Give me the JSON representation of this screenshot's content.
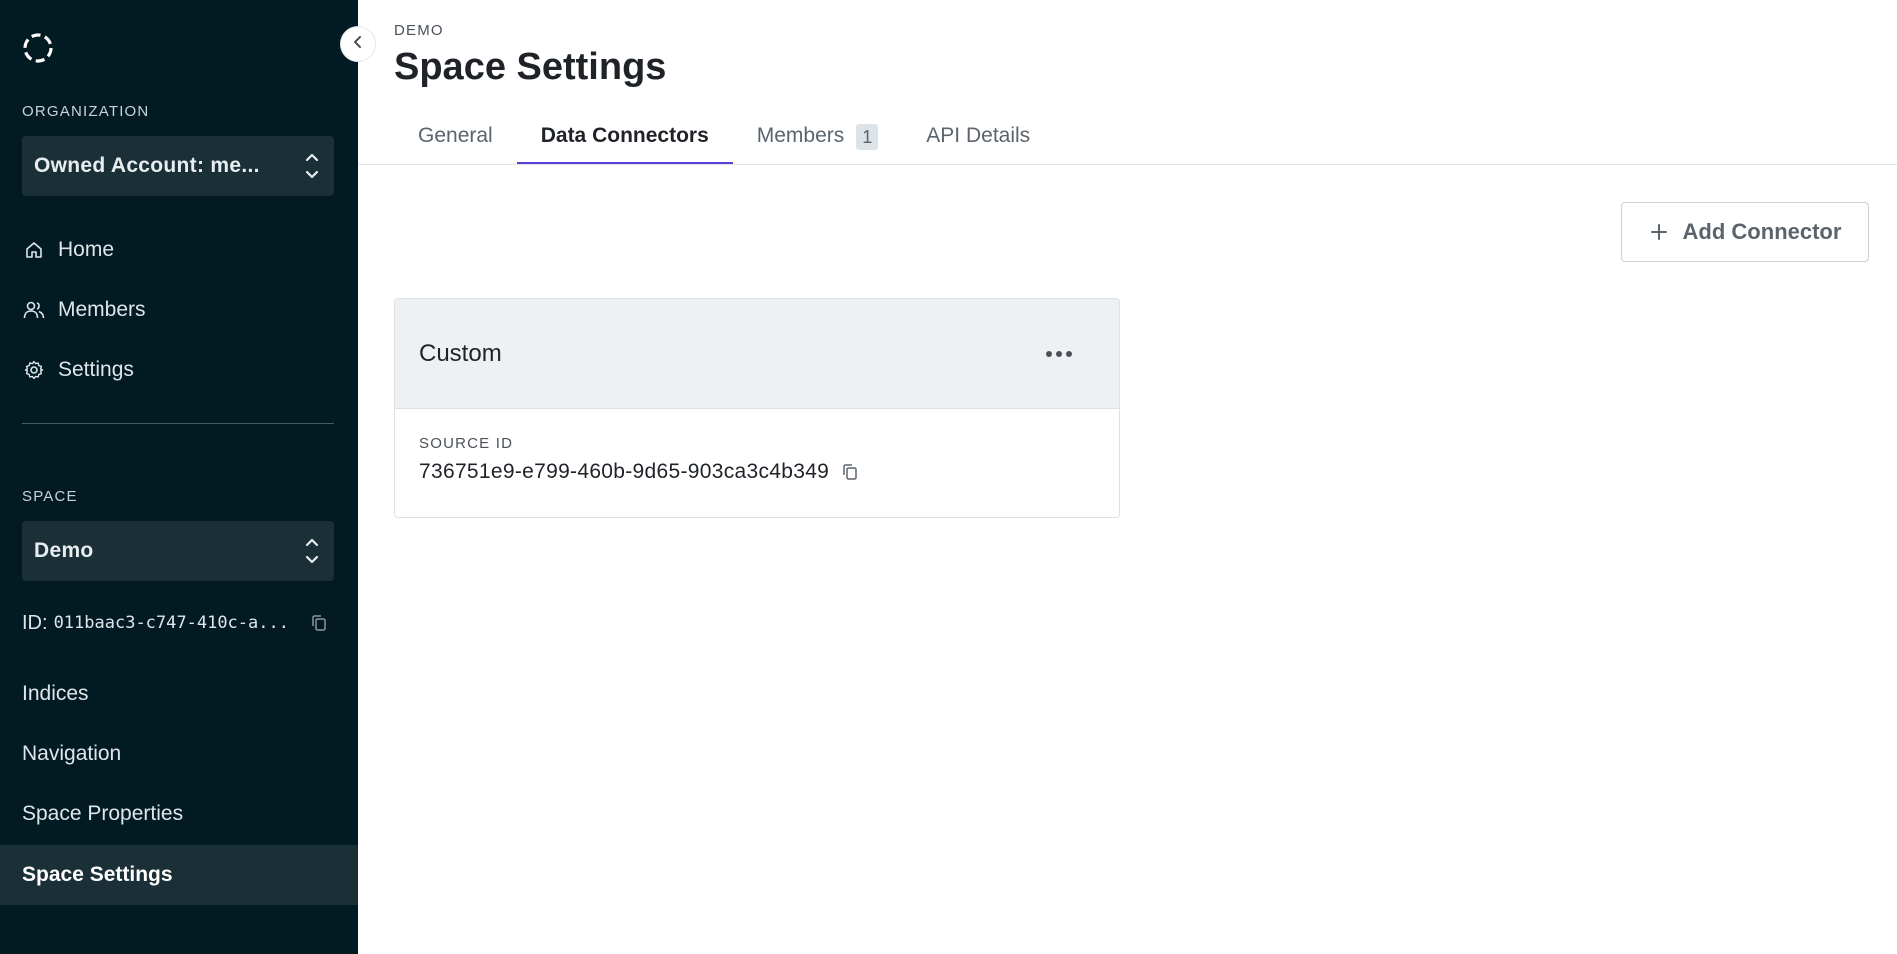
{
  "sidebar": {
    "organization_label": "ORGANIZATION",
    "organization_value": "Owned Account: me...",
    "nav": [
      {
        "label": "Home",
        "icon": "home-icon"
      },
      {
        "label": "Members",
        "icon": "users-icon"
      },
      {
        "label": "Settings",
        "icon": "gear-icon"
      }
    ],
    "space_label": "SPACE",
    "space_value": "Demo",
    "space_id_prefix": "ID:",
    "space_id_value": "011baac3-c747-410c-a...",
    "links": [
      "Indices",
      "Navigation",
      "Space Properties"
    ],
    "active_link": "Space Settings"
  },
  "main": {
    "breadcrumb": "DEMO",
    "title": "Space Settings",
    "tabs": [
      {
        "label": "General",
        "active": false
      },
      {
        "label": "Data Connectors",
        "active": true
      },
      {
        "label": "Members",
        "active": false,
        "badge": "1"
      },
      {
        "label": "API Details",
        "active": false
      }
    ],
    "add_button_label": "Add Connector",
    "connector": {
      "name": "Custom",
      "source_label": "SOURCE ID",
      "source_id": "736751e9-e799-460b-9d65-903ca3c4b349"
    }
  },
  "colors": {
    "sidebar_bg": "#021a22",
    "sidebar_select_bg": "#1b2f37",
    "tab_accent": "#5b3fd4"
  }
}
